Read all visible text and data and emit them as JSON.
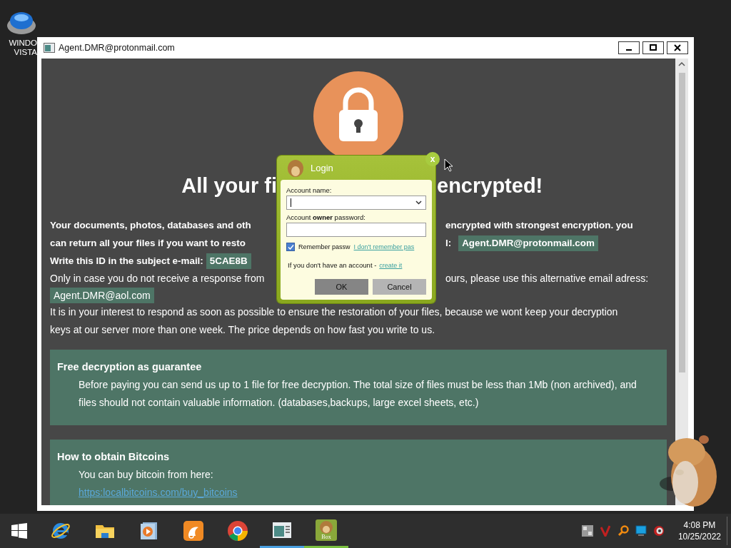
{
  "desktop": {
    "icons": [
      {
        "label_lines": [
          "WINDO",
          "VISTA"
        ]
      }
    ]
  },
  "window": {
    "title": "Agent.DMR@protonmail.com"
  },
  "note": {
    "heading": {
      "left": "All your fi",
      "right": "encrypted!"
    },
    "lines": [
      {
        "bold": true,
        "parts": [
          {
            "kind": "text",
            "text": "Your documents, photos, databases and oth"
          },
          {
            "kind": "gap"
          },
          {
            "kind": "text",
            "text": "encrypted with strongest encryption. you"
          }
        ]
      },
      {
        "bold": true,
        "parts": [
          {
            "kind": "text",
            "text": "can return all your files if you want to resto"
          },
          {
            "kind": "gap"
          },
          {
            "kind": "text",
            "text": "l:"
          },
          {
            "kind": "badge",
            "text": "Agent.DMR@protonmail.com"
          }
        ]
      },
      {
        "bold": true,
        "parts": [
          {
            "kind": "text",
            "text": "Write this ID in the subject e-mail:"
          },
          {
            "kind": "badge",
            "text": "5CAE8B"
          }
        ]
      },
      {
        "bold": false,
        "parts": [
          {
            "kind": "text",
            "text": "Only in case you do not receive a response from"
          },
          {
            "kind": "gap"
          },
          {
            "kind": "text",
            "text": "ours, please use this alternative email adress:"
          }
        ]
      },
      {
        "bold": false,
        "parts": [
          {
            "kind": "badge",
            "text": "Agent.DMR@aol.com"
          }
        ]
      },
      {
        "bold": false,
        "parts": [
          {
            "kind": "text",
            "text": "It is in your interest to respond as soon as possible to ensure the restoration of your files, because we wont keep your decryption keys at our server more than one week. The price depends on how fast you write to us."
          }
        ]
      }
    ],
    "cards": [
      {
        "title": "Free decryption as guarantee",
        "body": "Before paying you can send us up to 1 file for free decryption. The total size of files must be less than 1Mb (non archived), and files should not contain valuable information. (databases,backups, large excel sheets, etc.)"
      },
      {
        "title": "How to obtain Bitcoins",
        "body": "You can buy bitcoin from here:",
        "link": "https:localbitcoins.com/buy_bitcoins"
      }
    ]
  },
  "login": {
    "title": "Login",
    "close": "x",
    "fields": [
      {
        "kind": "combo",
        "label": "Account name:"
      },
      {
        "kind": "password",
        "label": "Account **owner** password:"
      }
    ],
    "remember": {
      "label": "Remember passw",
      "checked": true
    },
    "forgot_link": "I don't remember pas",
    "signup_text": "If you don't have an account -",
    "signup_link": "create it",
    "buttons": [
      {
        "kind": "primary",
        "label": "OK"
      },
      {
        "kind": "secondary",
        "label": "Cancel"
      }
    ]
  },
  "taskbar": {
    "apps": [
      {
        "kind": "ie",
        "open": false
      },
      {
        "kind": "folder",
        "open": false
      },
      {
        "kind": "media",
        "open": false
      },
      {
        "kind": "uc",
        "open": false
      },
      {
        "kind": "chrome",
        "open": false
      },
      {
        "kind": "window",
        "open": true
      },
      {
        "kind": "box",
        "open": true,
        "label": "Box"
      }
    ],
    "tray": [
      {
        "kind": "grid"
      },
      {
        "kind": "check"
      },
      {
        "kind": "magnifier"
      },
      {
        "kind": "monitor"
      },
      {
        "kind": "speaker"
      }
    ],
    "time": "4:08 PM",
    "date": "10/25/2022"
  }
}
